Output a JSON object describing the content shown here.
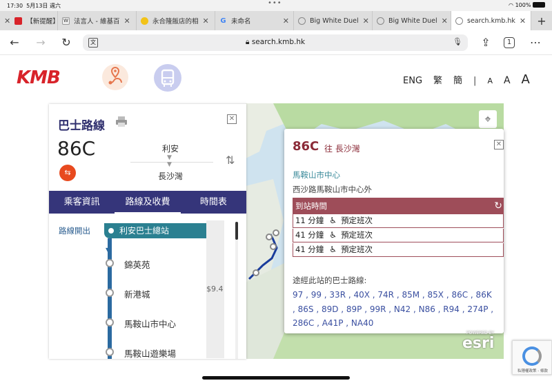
{
  "status_bar": {
    "time": "17:30",
    "date": "5月13日 週六",
    "dots": "•••",
    "battery": "100%"
  },
  "tabs": [
    {
      "label": "【新提醒】",
      "favicon_color": "#d8232a"
    },
    {
      "label": "法言人 - 維基百",
      "favicon_color": "#555555"
    },
    {
      "label": "永合隆飯店的相",
      "favicon_color": "#f2c318"
    },
    {
      "label": "未命名",
      "favicon_color": "#4285f4"
    },
    {
      "label": "Big White Duel",
      "favicon_color": "#888888"
    },
    {
      "label": "Big White Duel",
      "favicon_color": "#888888"
    },
    {
      "label": "search.kmb.hk",
      "favicon_color": "#888888"
    }
  ],
  "toolbar": {
    "url": "search.kmb.hk",
    "new_tab": "+"
  },
  "site": {
    "logo": "KMB",
    "lang": {
      "eng": "ENG",
      "trad": "繁",
      "simp": "簡",
      "sep": "|",
      "a_small": "A",
      "a_mid": "A",
      "a_large": "A"
    }
  },
  "panel": {
    "title": "巴士路線",
    "route_no": "86C",
    "from": "利安",
    "to": "長沙灣",
    "nav": [
      "乘客資訊",
      "路線及收費",
      "時間表"
    ],
    "route_depart_label": "路線開出",
    "first_stop": "利安巴士總站",
    "stops": [
      "錦英苑",
      "新港城",
      "馬鞍山市中心",
      "馬鞍山遊樂場"
    ],
    "fare": "$9.4"
  },
  "popup": {
    "route": "86C",
    "direction": "往 長沙灣",
    "stop_name": "馬鞍山市中心",
    "address": "西沙路馬鞍山市中心外",
    "eta_header": "到站時間",
    "eta_rows": [
      {
        "mins": "11 分鐘",
        "note": "預定班次"
      },
      {
        "mins": "41 分鐘",
        "note": "預定班次"
      },
      {
        "mins": "41 分鐘",
        "note": "預定班次"
      }
    ],
    "routes_label": "途經此站的巴士路線:",
    "routes": "97 , 99 , 33R , 40X , 74R , 85M , 85X , 86C , 86K , 86S , 89D , 89P , 99R , N42 , N86 , R94 , 274P , 286C , A41P , NA40"
  },
  "map": {
    "powered_by": "POWERED BY",
    "provider": "esri"
  },
  "recaptcha": {
    "text": "私隱權政策 - 條款"
  }
}
